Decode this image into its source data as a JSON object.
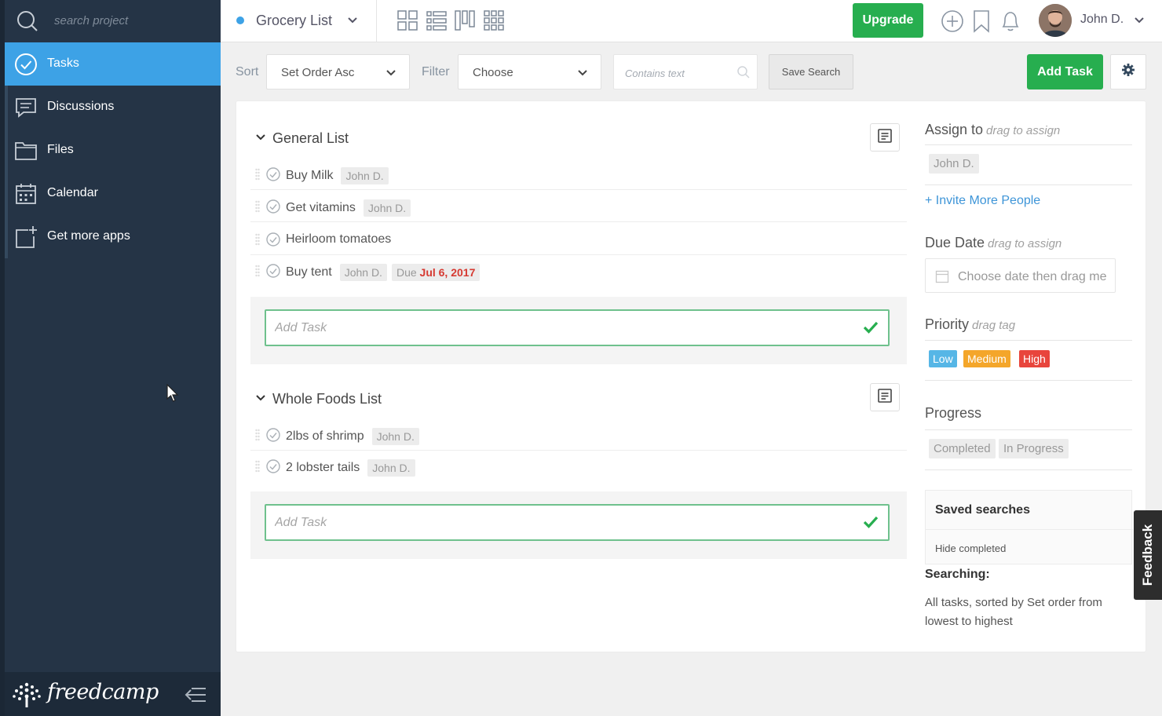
{
  "sidebar": {
    "search_placeholder": "search project",
    "items": [
      {
        "label": "Tasks",
        "icon": "check-circle-icon",
        "active": true
      },
      {
        "label": "Discussions",
        "icon": "chat-icon"
      },
      {
        "label": "Files",
        "icon": "folder-icon"
      },
      {
        "label": "Calendar",
        "icon": "calendar-icon"
      },
      {
        "label": "Get more apps",
        "icon": "add-app-icon"
      }
    ],
    "brand": "freedcamp"
  },
  "topbar": {
    "project_title": "Grocery List",
    "upgrade_label": "Upgrade",
    "user_name": "John D."
  },
  "toolbar": {
    "sort_label": "Sort",
    "sort_value": "Set Order Asc",
    "filter_label": "Filter",
    "filter_value": "Choose",
    "search_placeholder": "Contains text",
    "save_search_label": "Save Search",
    "add_task_label": "Add Task"
  },
  "lists": [
    {
      "title": "General List",
      "tasks": [
        {
          "name": "Buy Milk",
          "assignee": "John D."
        },
        {
          "name": "Get vitamins",
          "assignee": "John D."
        },
        {
          "name": "Heirloom tomatoes"
        },
        {
          "name": "Buy tent",
          "assignee": "John D.",
          "due_label": "Due",
          "due_date": "Jul 6, 2017"
        }
      ],
      "add_placeholder": "Add Task"
    },
    {
      "title": "Whole Foods List",
      "tasks": [
        {
          "name": "2lbs of shrimp",
          "assignee": "John D."
        },
        {
          "name": "2 lobster tails",
          "assignee": "John D."
        }
      ],
      "add_placeholder": "Add Task"
    }
  ],
  "right_panel": {
    "assign_title": "Assign to",
    "assign_hint": "drag to assign",
    "assignee_tag": "John D.",
    "invite_label": "+ Invite More People",
    "due_title": "Due Date",
    "due_hint": "drag to assign",
    "date_placeholder": "Choose date then drag me",
    "priority_title": "Priority",
    "priority_hint": "drag tag",
    "priorities": [
      {
        "label": "Low",
        "color": "#56b6e6"
      },
      {
        "label": "Medium",
        "color": "#f4a62a"
      },
      {
        "label": "High",
        "color": "#e8453c"
      }
    ],
    "progress_title": "Progress",
    "progress_tags": [
      "Completed",
      "In Progress"
    ],
    "saved_searches_title": "Saved searches",
    "saved_items": [
      "Hide completed"
    ],
    "searching_label": "Searching:",
    "searching_desc": "All tasks, sorted by Set order from lowest to highest"
  },
  "feedback_label": "Feedback",
  "colors": {
    "accent_blue": "#3da2e6",
    "green": "#27ae4f",
    "sidebar": "#253446"
  }
}
